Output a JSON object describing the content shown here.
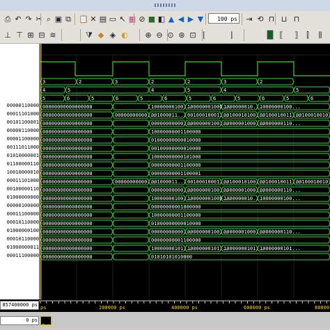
{
  "toolbar1": {
    "icons": [
      "print-icon",
      "undo-icon",
      "redo-icon",
      "cut-icon",
      "find-icon",
      "zoom-fit-icon",
      "copy-icon",
      "paste-icon",
      "delete-icon",
      "save-icon",
      "open-icon",
      "select-icon",
      "fill-icon",
      "run-icon",
      "stop-icon",
      "back-icon",
      "up-icon",
      "left-arrow-icon",
      "right-arrow-icon",
      "down-icon",
      "step-icon",
      "restart-icon",
      "wave-a-icon",
      "wave-b-icon",
      "wave-c-icon"
    ],
    "run_length": "100 ps"
  },
  "toolbar2": {
    "icons": [
      "insert-wave-icon",
      "insert-divider-icon",
      "insert-group-icon",
      "remove-icon",
      "wave-type-icon",
      "filter-icon",
      "color-icon",
      "find-signal-icon",
      "marker-icon",
      "zoom-in-icon",
      "zoom-out-icon",
      "zoom-full-icon",
      "zoom-cursor-icon",
      "zoom-mark-icon",
      "cursor-a-icon",
      "cursor-b-icon",
      "cursor-c-icon",
      "expand-icon",
      "collapse-icon",
      "snap-icon",
      "lock-icon"
    ]
  },
  "signal_names": [
    "",
    "",
    "",
    "",
    "00000110000",
    "00011101000",
    "00101100001",
    "00000110000",
    "00001100000",
    "00111011000",
    "01010000001",
    "01100000110",
    "10010000010",
    "00011101000",
    "00100000110",
    "01000000000",
    "00000100000",
    "00011100000",
    "00010110000",
    "01000000100",
    "00010110000",
    "01000000011",
    "00011100000"
  ],
  "waves": {
    "row2_values": [
      "3",
      "2",
      "3",
      "2",
      "2",
      "3",
      "2"
    ],
    "row3_values": [
      "4",
      "5",
      "4",
      "5",
      "4",
      "5"
    ],
    "row4_values": [
      "5",
      "6",
      "5",
      "6",
      "5",
      "6",
      "5",
      "6",
      "5",
      "6",
      "5",
      "6"
    ],
    "bus_rows": [
      [
        "00000000000000000",
        "",
        "10000000100...",
        "100000001000...",
        "1000000010...",
        "10000000100..."
      ],
      [
        "00000000000000000",
        "00000000000...",
        "001000011...",
        "00100010001...",
        "00100010100...",
        "00100010011...",
        "00100010010..."
      ],
      [
        "00000000000000000",
        "",
        "00000000000...",
        "00000000100...",
        "00000001000...",
        "00000000110..."
      ],
      [
        "00000000000000000",
        "",
        "10000000001100000"
      ],
      [
        "00000000000000000",
        "",
        "01000000000010000"
      ],
      [
        "00000000000000000",
        "",
        "00100000000010000"
      ],
      [
        "00000000000000000",
        "",
        "10000000000101000"
      ],
      [
        "00000000000000000",
        "",
        "00000000001100000"
      ],
      [
        "00000000000000000",
        "",
        "00000000001100001"
      ],
      [
        "00000000000000000",
        "00000000000...",
        "001000011...",
        "00100010001...",
        "00100010100...",
        "00100010011...",
        "00100010010..."
      ],
      [
        "00000000000000000",
        "",
        "00000000000...",
        "00000000100...",
        "00000001000...",
        "00000000110..."
      ],
      [
        "00000000000000000",
        "",
        "10000000100...",
        "100000001000...",
        "1000000010...",
        "10000000100..."
      ],
      [
        "00000000000000000",
        "",
        "00000000001000000"
      ],
      [
        "00000000000000000",
        "",
        "10000000001100000"
      ],
      [
        "00000000000000000",
        "",
        "01000000000010000"
      ],
      [
        "00000000000000000",
        "",
        "00000000000...",
        "00000000100...",
        "00000001000...",
        "00000000110..."
      ],
      [
        "00000000000000000",
        "",
        "00000000001100000"
      ],
      [
        "00000000000000000",
        "",
        "10000000101...",
        "10000000101...",
        "10000000101...",
        "10000000101..."
      ],
      [
        "00000000000000000",
        "",
        "01010101010000"
      ]
    ]
  },
  "timeline": {
    "now_time": "857400000 ps",
    "ticks": [
      "ps",
      "200000 ps",
      "400000 ps",
      "600000 ps",
      "80000"
    ]
  },
  "cursor": {
    "cursor_label": "0 ps",
    "cursor_value": "0 ps"
  }
}
